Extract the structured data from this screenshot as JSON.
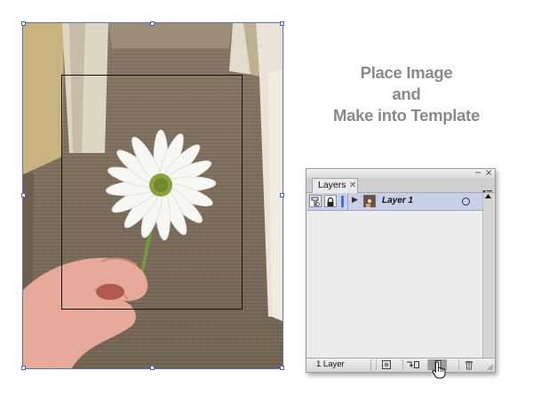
{
  "caption": {
    "line1": "Place Image",
    "line2": "and",
    "line3": "Make into Template"
  },
  "layers_panel": {
    "tab_label": "Layers",
    "tab_close_glyph": "✕",
    "minimize_glyph": "−",
    "close_glyph": "×",
    "menu_icon": "panel-menu-icon",
    "layers": [
      {
        "name": "Layer 1",
        "visible": true,
        "locked": true,
        "template": true,
        "color": "#4c6cf0",
        "expanded": false,
        "targeted": false
      }
    ],
    "status": "1 Layer",
    "bottom_buttons": [
      {
        "name": "make-clipping-mask",
        "icon": "clipping-mask-icon"
      },
      {
        "name": "create-sublayer",
        "icon": "new-sublayer-icon"
      },
      {
        "name": "create-new-layer",
        "icon": "new-layer-icon",
        "pressed": true
      },
      {
        "name": "delete-layer",
        "icon": "trash-icon"
      }
    ]
  },
  "colors": {
    "selection": "#4a62cc",
    "caption_text": "#8a8a8a",
    "layer_highlight": "#c8d0e8"
  }
}
